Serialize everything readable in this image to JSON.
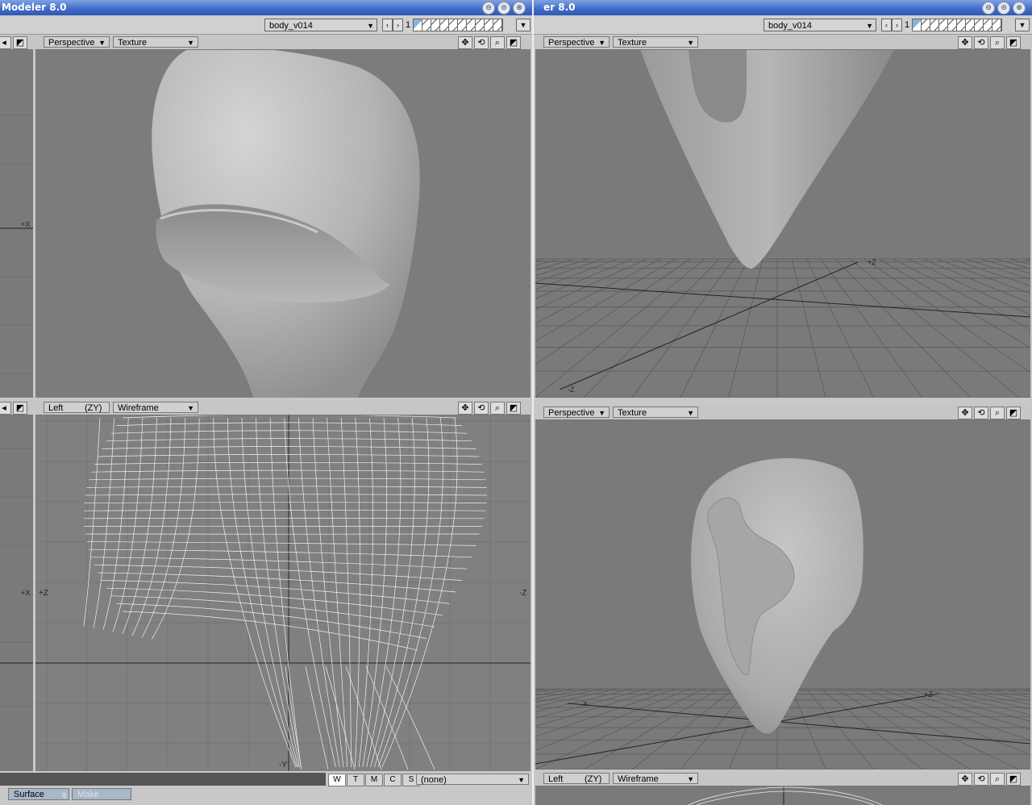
{
  "left_window": {
    "title": "Modeler 8.0",
    "layer_name": "body_v014",
    "layer_number": "1",
    "viewports": {
      "top_right": {
        "view": "Perspective",
        "shading": "Texture"
      },
      "bottom_right": {
        "view": "Left",
        "axes": "(ZY)",
        "shading": "Wireframe",
        "axis_labels": {
          "left": "+Z",
          "right": "-Z",
          "bottom": "-Y",
          "stub_x": "+X"
        }
      }
    },
    "stub_labels": {
      "top": "+X",
      "bottom": "+X"
    },
    "bottom_bar": {
      "wtmcs": [
        "W",
        "T",
        "M",
        "C",
        "S"
      ],
      "surface_dropdown": "(none)",
      "surface_label": "Surface",
      "surface_hotkey": "q",
      "make_label": "Make"
    }
  },
  "right_window": {
    "title": "er 8.0",
    "layer_name": "body_v014",
    "layer_number": "1",
    "viewports": {
      "top": {
        "view": "Perspective",
        "shading": "Texture",
        "axis_labels": [
          "+Z",
          "-Z"
        ]
      },
      "middle": {
        "view": "Perspective",
        "shading": "Texture",
        "axis_labels": [
          "-X",
          "+Z"
        ]
      },
      "bottom": {
        "view": "Left",
        "axes": "(ZY)",
        "shading": "Wireframe"
      }
    }
  },
  "window_controls": [
    "⊖",
    "⊙",
    "⊗"
  ],
  "colors": {
    "titlebar": "#3f6bc8",
    "viewport_bg": "#7a7a7a",
    "panel": "#c8c8c8"
  }
}
